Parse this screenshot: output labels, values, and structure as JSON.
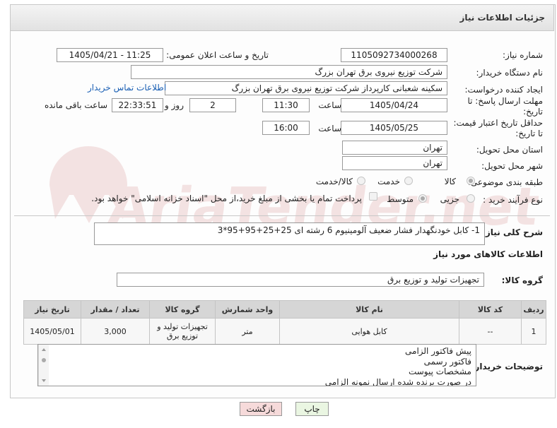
{
  "header": {
    "title": "جزئیات اطلاعات نیاز"
  },
  "form": {
    "need_number": {
      "label": "شماره نیاز:",
      "value": "1105092734000268"
    },
    "announce": {
      "label": "تاریخ و ساعت اعلان عمومی:",
      "value": "1405/04/21 - 11:25"
    },
    "buyer": {
      "label": "نام دستگاه خریدار:",
      "value": "شرکت توزیع نیروی برق تهران بزرگ"
    },
    "requester": {
      "label": "ایجاد کننده درخواست:",
      "value": "سکینه شعبانی کارپرداز شرکت توزیع نیروی برق تهران بزرگ",
      "contact_link": "اطلاعات تماس خریدار"
    },
    "deadline": {
      "label_line1": "مهلت ارسال پاسخ: تا",
      "label_line2": "تاریخ:",
      "date": "1405/04/24",
      "time_label": "ساعت",
      "time": "11:30",
      "days": "2",
      "days_label": "روز و",
      "remaining": "22:33:51",
      "remaining_label": "ساعت باقی مانده"
    },
    "validity": {
      "label_line1": "حداقل تاریخ اعتبار قیمت:",
      "label_line2": "تا تاریخ:",
      "date": "1405/05/25",
      "time_label": "ساعت",
      "time": "16:00"
    },
    "province": {
      "label": "استان محل تحویل:",
      "value": "تهران"
    },
    "city": {
      "label": "شهر محل تحویل:",
      "value": "تهران"
    },
    "category": {
      "label": "طبقه بندی موضوعی:",
      "options": [
        "کالا",
        "خدمت",
        "کالا/خدمت"
      ],
      "selected": "کالا"
    },
    "process": {
      "label": "نوع فرآیند خرید :",
      "options": [
        "جزیی",
        "متوسط"
      ],
      "selected": "متوسط",
      "payment_note": "پرداخت تمام یا بخشی از مبلغ خرید،از محل \"اسناد خزانه اسلامی\" خواهد بود."
    }
  },
  "summary": {
    "label": "شرح کلی نیاز:",
    "value": "1- کابل خودنگهدار فشار ضعیف آلومینیوم 6 رشته ای 25+25+95+95*3"
  },
  "goods": {
    "section_title": "اطلاعات کالاهای مورد نیاز",
    "group_label": "گروه کالا:",
    "group_value": "تجهیزات تولید و توزیع برق",
    "columns": [
      "ردیف",
      "کد کالا",
      "نام کالا",
      "واحد شمارش",
      "گروه کالا",
      "تعداد / مقدار",
      "تاریخ نیاز"
    ],
    "rows": [
      {
        "row": "1",
        "code": "--",
        "name": "کابل هوایی",
        "unit": "متر",
        "group": "تجهیزات تولید و توزیع برق",
        "qty": "3,000",
        "date": "1405/05/01"
      }
    ]
  },
  "buyer_notes": {
    "label": "توضیحات خریدار:",
    "lines": [
      "پیش فاکتور الزامی",
      "فاکتور رسمی",
      "مشخصات پیوست",
      "در صورت برنده شده ارسال نمونه الزامی"
    ]
  },
  "buttons": {
    "print": "چاپ",
    "back": "بازگشت"
  },
  "watermark": "AriaTender.net",
  "colors": {
    "link": "#1a5fb4",
    "back_button": "#f6dada",
    "print_button": "#eaf6e2",
    "watermark": "#e7c8c8"
  }
}
